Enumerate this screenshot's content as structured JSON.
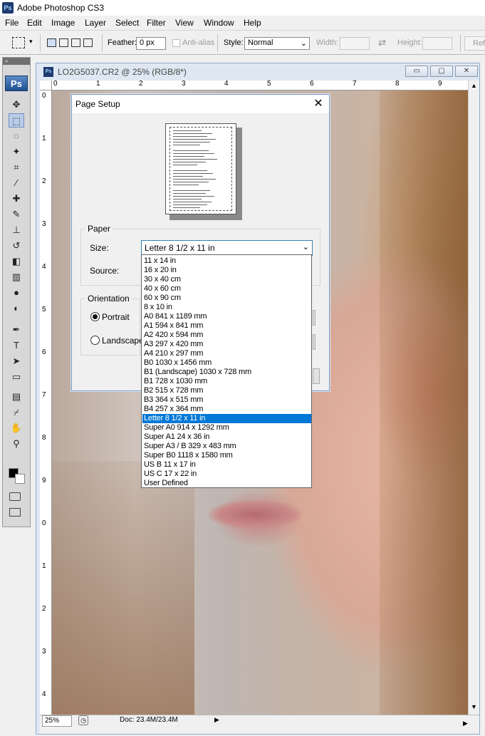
{
  "app": {
    "icon_text": "Ps",
    "title": "Adobe Photoshop CS3"
  },
  "menubar": {
    "items": [
      "File",
      "Edit",
      "Image",
      "Layer",
      "Select",
      "Filter",
      "View",
      "Window",
      "Help"
    ]
  },
  "options": {
    "feather_label": "Feather:",
    "feather_value": "0 px",
    "antialias_label": "Anti-alias",
    "style_label": "Style:",
    "style_value": "Normal",
    "width_label": "Width:",
    "height_label": "Height:",
    "refine_label": "Refi"
  },
  "toolbox": {
    "logo_text": "Ps",
    "tools": [
      {
        "name": "move-tool-icon",
        "glyph": "✥"
      },
      {
        "name": "marquee-tool-icon",
        "glyph": "⬚",
        "selected": true
      },
      {
        "name": "lasso-tool-icon",
        "glyph": "◌"
      },
      {
        "name": "magic-wand-tool-icon",
        "glyph": "✦"
      },
      {
        "name": "crop-tool-icon",
        "glyph": "⌗"
      },
      {
        "name": "slice-tool-icon",
        "glyph": "⁄"
      },
      {
        "name": "healing-brush-tool-icon",
        "glyph": "✚"
      },
      {
        "name": "brush-tool-icon",
        "glyph": "✎"
      },
      {
        "name": "clone-stamp-tool-icon",
        "glyph": "⊥"
      },
      {
        "name": "history-brush-tool-icon",
        "glyph": "↺"
      },
      {
        "name": "eraser-tool-icon",
        "glyph": "◧"
      },
      {
        "name": "gradient-tool-icon",
        "glyph": "▥"
      },
      {
        "name": "blur-tool-icon",
        "glyph": "●"
      },
      {
        "name": "dodge-tool-icon",
        "glyph": "◐"
      },
      {
        "name": "pen-tool-icon",
        "glyph": "✒"
      },
      {
        "name": "type-tool-icon",
        "glyph": "T"
      },
      {
        "name": "path-selection-tool-icon",
        "glyph": "➤"
      },
      {
        "name": "shape-tool-icon",
        "glyph": "▭"
      },
      {
        "name": "notes-tool-icon",
        "glyph": "▤"
      },
      {
        "name": "eyedropper-tool-icon",
        "glyph": "⌿"
      },
      {
        "name": "hand-tool-icon",
        "glyph": "✋"
      },
      {
        "name": "zoom-tool-icon",
        "glyph": "⚲"
      }
    ]
  },
  "document": {
    "icon_text": "Ps",
    "title": "LO2G5037.CR2 @ 25% (RGB/8*)",
    "minimize_label": "▭",
    "maximize_label": "▢",
    "close_label": "✕",
    "ruler_top": [
      "0",
      "1",
      "2",
      "3",
      "4",
      "5",
      "6",
      "7",
      "8",
      "9"
    ],
    "ruler_left": [
      "0",
      "1",
      "2",
      "3",
      "4",
      "5",
      "6",
      "7",
      "8",
      "9",
      "0",
      "1",
      "2",
      "3",
      "4"
    ]
  },
  "dialog": {
    "title": "Page Setup",
    "close_label": "✕",
    "paper_group": "Paper",
    "size_label": "Size:",
    "size_value": "Letter 8 1/2 x 11 in",
    "source_label": "Source:",
    "orientation_group": "Orientation",
    "portrait_label": "Portrait",
    "landscape_label": "Landscape",
    "orientation_selected": "Portrait"
  },
  "size_options": [
    "11 x 14 in",
    "16 x 20 in",
    "30 x 40 cm",
    "40 x 60 cm",
    "60 x 90 cm",
    "8 x 10 in",
    "A0 841 x 1189 mm",
    "A1 594 x 841 mm",
    "A2 420 x 594 mm",
    "A3 297 x 420 mm",
    "A4 210 x 297 mm",
    "B0 1030 x 1456 mm",
    "B1 (Landscape) 1030 x 728 mm",
    "B1 728 x 1030 mm",
    "B2 515 x 728 mm",
    "B3 364 x 515 mm",
    "B4 257 x 364 mm",
    "Letter 8 1/2 x 11 in",
    "Super A0 914 x 1292 mm",
    "Super A1 24 x 36 in",
    "Super A3 / B 329 x 483 mm",
    "Super B0 1118 x 1580 mm",
    "US B 11 x 17 in",
    "US C 17 x 22 in",
    "User Defined"
  ],
  "size_selected_index": 17,
  "status": {
    "zoom": "25%",
    "doc_info": "Doc: 23.4M/23.4M"
  }
}
